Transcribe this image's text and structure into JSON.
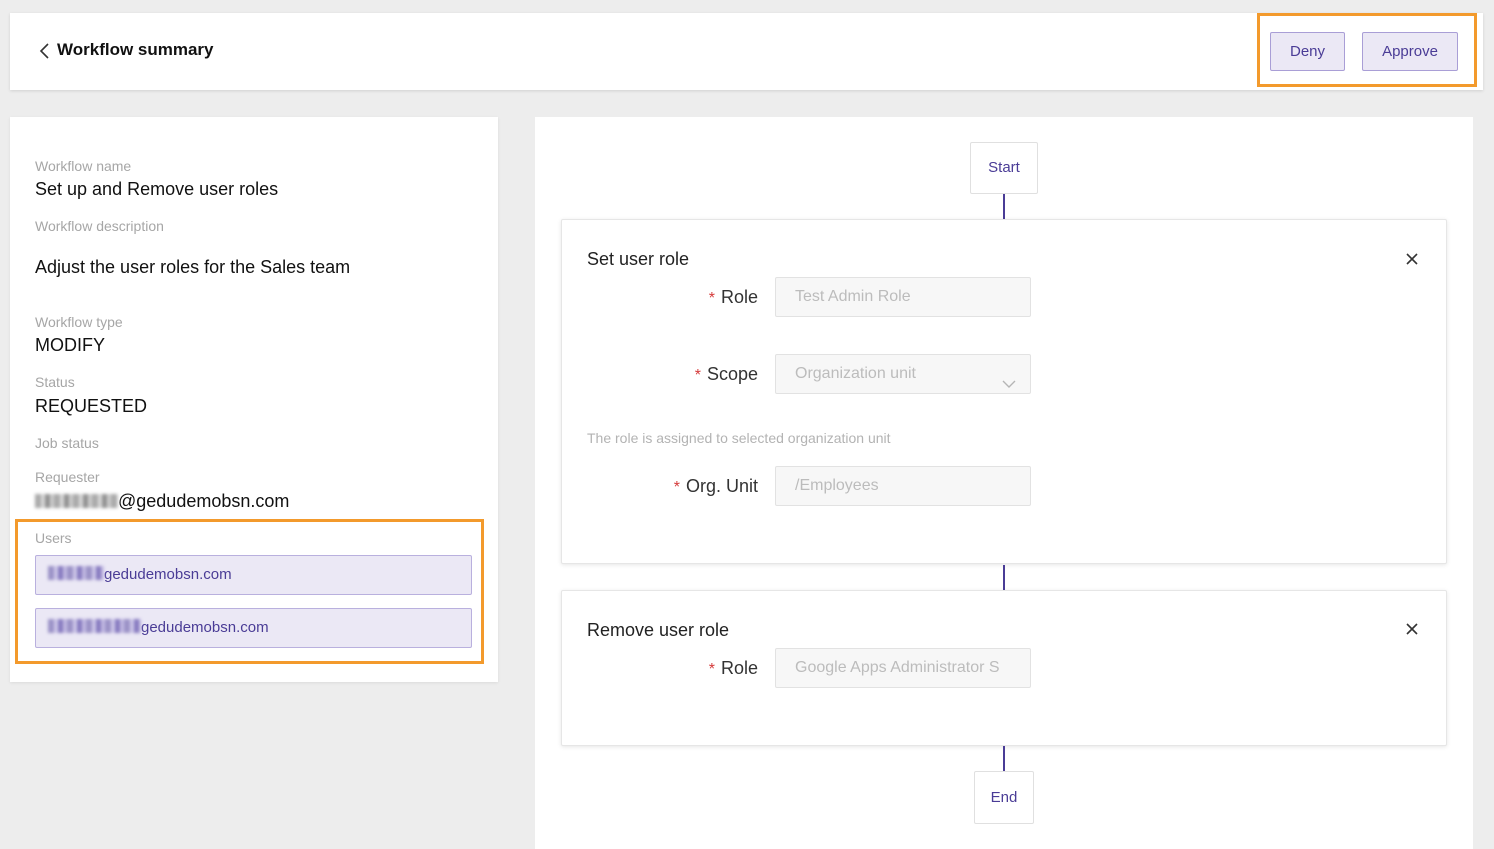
{
  "header": {
    "title": "Workflow summary",
    "back_icon": "chevron-left-icon",
    "deny_label": "Deny",
    "approve_label": "Approve"
  },
  "details": {
    "workflow_name_label": "Workflow name",
    "workflow_name": "Set up and Remove user roles",
    "workflow_description_label": "Workflow description",
    "workflow_description": "Adjust the user roles for the Sales team",
    "workflow_type_label": "Workflow type",
    "workflow_type": "MODIFY",
    "status_label": "Status",
    "status": "REQUESTED",
    "job_status_label": "Job status",
    "requester_label": "Requester",
    "requester_visible": "@gedudemobsn.com",
    "users_label": "Users",
    "users": [
      {
        "visible": "gedudemobsn.com"
      },
      {
        "visible": "gedudemobsn.com"
      }
    ]
  },
  "flow": {
    "start_label": "Start",
    "end_label": "End",
    "line_color": "#4a3c96",
    "set_role": {
      "title": "Set user role",
      "role_label": "Role",
      "role_value": "Test Admin Role",
      "scope_label": "Scope",
      "scope_value": "Organization unit",
      "hint": "The role is assigned to selected organization unit",
      "org_unit_label": "Org. Unit",
      "org_unit_value": "/Employees"
    },
    "remove_role": {
      "title": "Remove user role",
      "role_label": "Role",
      "role_value": "Google Apps Administrator S"
    }
  },
  "colors": {
    "accent": "#4a3c96",
    "highlight": "#f39a2c",
    "required": "#d53a3a"
  }
}
